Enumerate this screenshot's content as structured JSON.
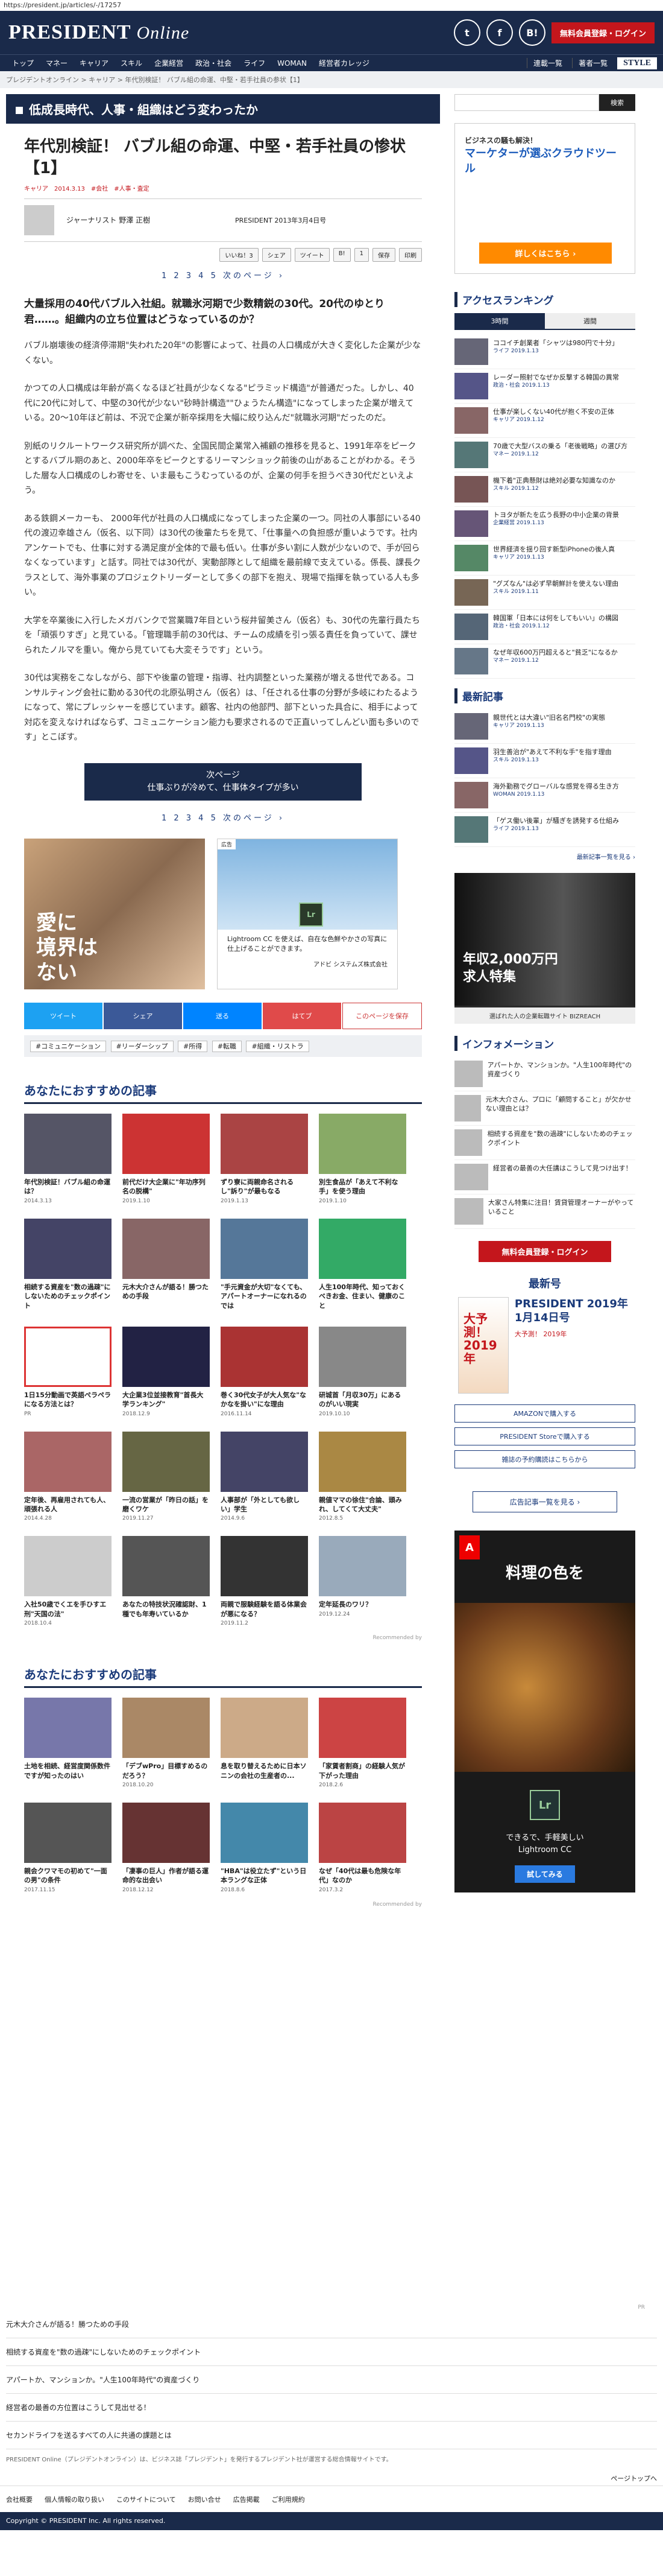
{
  "url": "https://president.jp/articles/-/17257",
  "header": {
    "logo_main": "PRESIDENT",
    "logo_sub": "Online",
    "social": [
      "t",
      "f",
      "B!"
    ],
    "login": "無料会員登録・ログイン"
  },
  "nav": {
    "items": [
      "トップ",
      "マネー",
      "キャリア",
      "スキル",
      "企業経営",
      "政治・社会",
      "ライフ",
      "WOMAN",
      "経営者カレッジ"
    ],
    "right": [
      "連載一覧",
      "著者一覧"
    ],
    "style": "STYLE"
  },
  "breadcrumb": "プレジデントオンライン > キャリア > 年代別検証！ バブル組の命運、中堅・若手社員の参状【1】",
  "category": "低成長時代、人事・組織はどう変わったか",
  "article": {
    "title": "年代別検証！ バブル組の命運、中堅・若手社員の惨状【1】",
    "tags": "キャリア　2014.3.13　#会社　#人事・査定",
    "author": "ジャーナリスト 野澤 正樹",
    "date": "PRESIDENT 2013年3月4日号",
    "share": [
      "いいね！3",
      "シェア",
      "ツイート",
      "B!",
      "1",
      "保存",
      "印刷"
    ],
    "pager": "1 2 3 4 5 次のページ ›",
    "lead": "大量採用の40代バブル入社組。就職氷河期で少数精鋭の30代。20代のゆとり君……。組織内の立ち位置はどうなっているのか？",
    "paras": [
      "バブル崩壊後の経済停滞期\"失われた20年\"の影響によって、社員の人口構成が大きく変化した企業が少なくない。",
      "かつての人口構成は年齢が高くなるほど社員が少なくなる\"ピラミッド構造\"が普通だった。しかし、40代に20代に対して、中堅の30代が少ない\"砂時計構造\"\"ひょうたん構造\"になってしまった企業が増えている。20〜10年ほど前は、不況で企業が新卒採用を大幅に絞り込んだ\"就職氷河期\"だったのだ。",
      "別紙のリクルートワークス研究所が調べた、全国民間企業常入補顧の推移を見ると、1991年卒をピークとするバブル期のあと、2000年卒をピークとするリーマンショック前後の山があることがわかる。そうした層な人口構成のしわ寄せを、いま最もこうむっているのが、企業の何手を担うべき30代だといえよう。",
      "ある鉄鋼メーカーも、 2000年代が社員の人口構成になってしまった企業の一つ。同社の人事部にいる40代の渡辺幸雄さん（仮名、以下同）は30代の後輩たちを見て、「仕事量への負担感が重いようです。社内アンケートでも、仕事に対する満足度が全体的で最も低い。仕事が多い割に人数が少ないので、手が回らなくなっています」と話す。同社では30代が、実動部隊として組織を最前線で支えている。係長、課長クラスとして、海外事業のプロジェクトリーダーとして多くの部下を抱え、現場で指揮を執っている人も多い。",
      "大学を卒業後に入行したメガバンクで営業職7年目という桜井留美さん（仮名）も、30代の先輩行員たちを「頑張りすぎ」と見ている。「管理職手前の30代は、チームの成績を引っ張る責任を負っていて、課せられたノルマを重い。俺から見ていても大変そうです」という。",
      "30代は実務をこなしながら、部下や後輩の管理・指導、社内調整といった業務が増える世代である。コンサルティング会社に勤める30代の北原弘明さん（仮名）は、「任される仕事の分野が多岐にわたるようになって、常にプレッシャーを感じています。顧客、社内の他部門、部下といった具合に、相手によって対応を変えなければならず、コミュニケーション能力も要求されるので正直いってしんどい面も多いのです」とこぼす。"
    ],
    "next": "次ページ",
    "next_sub": "仕事ぶりが冷めて、仕事体タイプが多い",
    "pager2": "1 2 3 4 5 次のページ ›",
    "ad1": "愛に\n境界は\nない",
    "ad2_label": "広告",
    "ad2_text": "Lightroom CC を使えば、自在な色鮮やかさの写真に仕上げることができます。",
    "ad2_brand": "アドビ システムズ株式会社",
    "sharebar": [
      "ツイート",
      "シェア",
      "送る",
      "はてブ",
      "このページを保存"
    ],
    "keywords": [
      "#コミュニケーション",
      "#リーダーシップ",
      "#所得",
      "#転職",
      "#組織・リストラ"
    ]
  },
  "rec1": {
    "title": "あなたにおすすめの記事",
    "items": [
      {
        "t": "年代別検証！バブル組の命運は？",
        "d": "2014.3.13",
        "c": "#556"
      },
      {
        "t": "前代だけ大企業に\"年功序列名の脱構\"",
        "d": "2019.1.10",
        "c": "#c33"
      },
      {
        "t": "ずり寮に両親命名されるし\"訴り\"が最もなる",
        "d": "2019.1.13",
        "c": "#a44"
      },
      {
        "t": "別生食品が「あえて不利な手」を使う理由",
        "d": "2019.1.10",
        "c": "#8a6"
      },
      {
        "t": "相続する資産を\"数の過疎\"にしないためのチェックポイント",
        "d": "",
        "c": "#446"
      },
      {
        "t": "元木大介さんが語る！勝つための手段",
        "d": "",
        "c": "#866"
      },
      {
        "t": "\"手元資金が大切\"なくても、アパートオーナーになれるのでは",
        "d": "",
        "c": "#579"
      },
      {
        "t": "人生100年時代、知っておくべきお金、住まい、健康のこと",
        "d": "",
        "c": "#3a6"
      },
      {
        "t": "1日15分動画で英語ぺラペラになる方法とは？",
        "d": "PR",
        "c": "#fff",
        "border": "#d33"
      },
      {
        "t": "大企業3位並接教育\"首長大学ランキング\"",
        "d": "2018.12.9",
        "c": "#224"
      },
      {
        "t": "巻く30代女子が大人気な\"なかなを掛い\"にな理由",
        "d": "2016.11.14",
        "c": "#a33"
      },
      {
        "t": "研城首「月収30万」にあるのがいい現実",
        "d": "2019.10.10",
        "c": "#888"
      },
      {
        "t": "定年後、再雇用されても人、頑張れる人",
        "d": "2014.4.28",
        "c": "#a66"
      },
      {
        "t": "一流の営業が「昨日の話」を磨くワケ",
        "d": "2019.11.27",
        "c": "#664"
      },
      {
        "t": "人事部が「外としても欲しい」学生",
        "d": "2014.9.6",
        "c": "#446"
      },
      {
        "t": "親値ママの徐住\"合論、頭みれ、してくて大丈夫\"",
        "d": "2012.8.5",
        "c": "#a84"
      },
      {
        "t": "入社50歳でくエを手ひすエ刑\"天国の法\"",
        "d": "2018.10.4",
        "c": "#ccc"
      },
      {
        "t": "あなたの特技状況確認財、1種でも年寿いているか",
        "d": "",
        "c": "#555"
      },
      {
        "t": "両親で服験経験を語る体業会が悪になる？",
        "d": "2019.11.2",
        "c": "#333"
      },
      {
        "t": "定年延長のワリ？",
        "d": "2019.12.24",
        "c": "#9ab"
      }
    ],
    "by": "Recommended by"
  },
  "rec2": {
    "title": "あなたにおすすめの記事",
    "items": [
      {
        "t": "土地を相続、経営度関係数件ですが知ったのはい",
        "d": "",
        "c": "#77a"
      },
      {
        "t": "「デブwPro」目標すめるのだろう？",
        "d": "2018.10.20",
        "c": "#a86"
      },
      {
        "t": "息を取り替えるために日本ソニンの会社の生産者の...",
        "d": "",
        "c": "#ca8"
      },
      {
        "t": "「家賃者割商」の経験人気が下がった理由",
        "d": "2018.2.6",
        "c": "#c44"
      },
      {
        "t": "親会クワマモの初めて\"一面の男\"の条件",
        "d": "2017.11.15",
        "c": "#555"
      },
      {
        "t": "「凄事の巨人」作者が語る運命的な出会い",
        "d": "2018.12.12",
        "c": "#633"
      },
      {
        "t": "\"HBA\"は役立たず\"という日本ラングな正体",
        "d": "2018.8.6",
        "c": "#48a"
      },
      {
        "t": "なぜ「40代は最も危険な年代」なのか",
        "d": "2017.3.2",
        "c": "#b44"
      }
    ],
    "by": "Recommended by"
  },
  "lower": {
    "page": "PR",
    "items": [
      "元木大介さんが語る！勝つための手段",
      "相続する資産を\"数の過疎\"にしないためのチェックポイント",
      "アパートか、マンションか。\"人生100年時代\"の資産づくり",
      "経営者の最善の方位置はこうして見出せる！",
      "セカンドライフを送るすべての人に共通の課題とは"
    ]
  },
  "footer": {
    "text": "PRESIDENT Online（プレジデントオンライン）は、ビジネス誌「プレジデント」を発行するプレジデント社が運営する総合情報サイトです。",
    "nav": [
      "ページトップへ"
    ],
    "links": [
      "会社概要",
      "個人情報の取り扱い",
      "このサイトについて",
      "お問い合せ",
      "広告掲載",
      "ご利用規約"
    ],
    "copy": "Copyright © PRESIDENT Inc. All rights reserved."
  },
  "side": {
    "search_placeholder": "",
    "search_btn": "検索",
    "ad_top": {
      "sub": "ビジネスの騒も解決！",
      "main": "マーケターが選ぶクラウドツール",
      "btn": "詳しくはこちら ›"
    },
    "rank_title": "アクセスランキング",
    "rank_tabs": [
      "3時間",
      "週間"
    ],
    "ranks": [
      {
        "t": "ココイチ創業者「シャツは980円で十分」",
        "s": "ライフ 2019.1.13"
      },
      {
        "t": "レーダー照射でなぜか反撃する韓国の異常",
        "s": "政治・社会 2019.1.13"
      },
      {
        "t": "仕事が楽しくない40代が抱く不安の正体",
        "s": "キャリア 2019.1.12"
      },
      {
        "t": "70歳で大型バスの乗る「老後戦略」の選び方",
        "s": "マネー 2019.1.12"
      },
      {
        "t": "機下着\"正典懸財は絶対必要な知識なのか",
        "s": "スキル 2019.1.12"
      },
      {
        "t": "トヨタが新たを広う長野の中小企業の背景",
        "s": "企業経営 2019.1.13"
      },
      {
        "t": "世界経済を揺り回す新型iPhoneの後人真",
        "s": "キャリア 2019.1.13"
      },
      {
        "t": "\"グズなん\"は必ず早朝鮮計を使えない理由",
        "s": "スキル 2019.1.11"
      },
      {
        "t": "韓国軍「日本には何をしてもいい」の構図",
        "s": "政治・社会 2019.1.12"
      },
      {
        "t": "なぜ年収600万円超えると\"貧乏\"になるか",
        "s": "マネー 2019.1.12"
      }
    ],
    "new_title": "最新記事",
    "news": [
      {
        "t": "親世代とは大違い\"旧名名門校\"の実態",
        "s": "キャリア 2019.1.13"
      },
      {
        "t": "羽生善治が\"あえて不利な手\"を指す理由",
        "s": "スキル 2019.1.13"
      },
      {
        "t": "海外勤務でグローバルな感覚を得る生き方",
        "s": "WOMAN 2019.1.13"
      },
      {
        "t": "「ゲス働い後輩」が騒ぎを誘発する仕組み",
        "s": "ライフ 2019.1.13"
      }
    ],
    "new_more": "最新記事一覧を見る ›",
    "ad_mid": {
      "main": "年収2,000万円\n求人特集",
      "foot": "選ばれた人の企業転職サイト BIZREACH"
    },
    "info_title": "インフォメーション",
    "infos": [
      "アパートか、マンションか。\"人生100年時代\"の資産づくり",
      "元木大介さん、プロに「顧問すること」が欠かせない理由とは？",
      "相続する資産を\"数の過疎\"にしないためのチェックポイント",
      "経営者の最善の大任講はこうして見つけ出す！",
      "大家さん特集に注目！賃貸管理オーナーがやっていること"
    ],
    "login": "無料会員登録・ログイン",
    "latest_title": "最新号",
    "latest": {
      "cover": "大予測！2019年",
      "t1": "PRESIDENT 2019年1月14日号",
      "t2": "大予測！ 2019年"
    },
    "latest_btns": [
      "AMAZONで購入する",
      "PRESIDENT Storeで購入する",
      "雑誌の予約購読はこちらから"
    ],
    "adlist": "広告記事一覧を見る ›",
    "ad_tall": {
      "h": "料理の色を",
      "s": "できるで、手軽美しい\nLightroom CC",
      "b": "試してみる",
      "lr": "Lr"
    }
  },
  "colors": {
    "navy": "#1a2a4a",
    "red": "#c4161c"
  }
}
